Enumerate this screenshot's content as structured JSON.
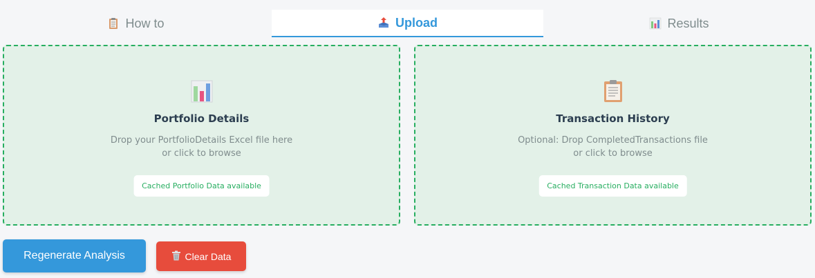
{
  "tabs": [
    {
      "label": "How to",
      "icon": "clipboard-icon",
      "active": false
    },
    {
      "label": "Upload",
      "icon": "upload-icon",
      "active": true
    },
    {
      "label": "Results",
      "icon": "bar-chart-icon",
      "active": false
    }
  ],
  "zones": {
    "portfolio": {
      "icon": "bar-chart-icon",
      "title": "Portfolio Details",
      "desc_line1": "Drop your PortfolioDetails Excel file here",
      "desc_line2": "or click to browse",
      "badge": "Cached Portfolio Data available"
    },
    "transactions": {
      "icon": "clipboard-icon",
      "title": "Transaction History",
      "desc_line1": "Optional: Drop CompletedTransactions file",
      "desc_line2": "or click to browse",
      "badge": "Cached Transaction Data available"
    }
  },
  "actions": {
    "regenerate_label": "Regenerate Analysis",
    "clear_label": "Clear Data",
    "clear_icon": "trash-icon"
  },
  "colors": {
    "accent": "#3498db",
    "success": "#27ae60",
    "danger": "#e74c3c",
    "zone_bg": "#e3f1e8"
  }
}
